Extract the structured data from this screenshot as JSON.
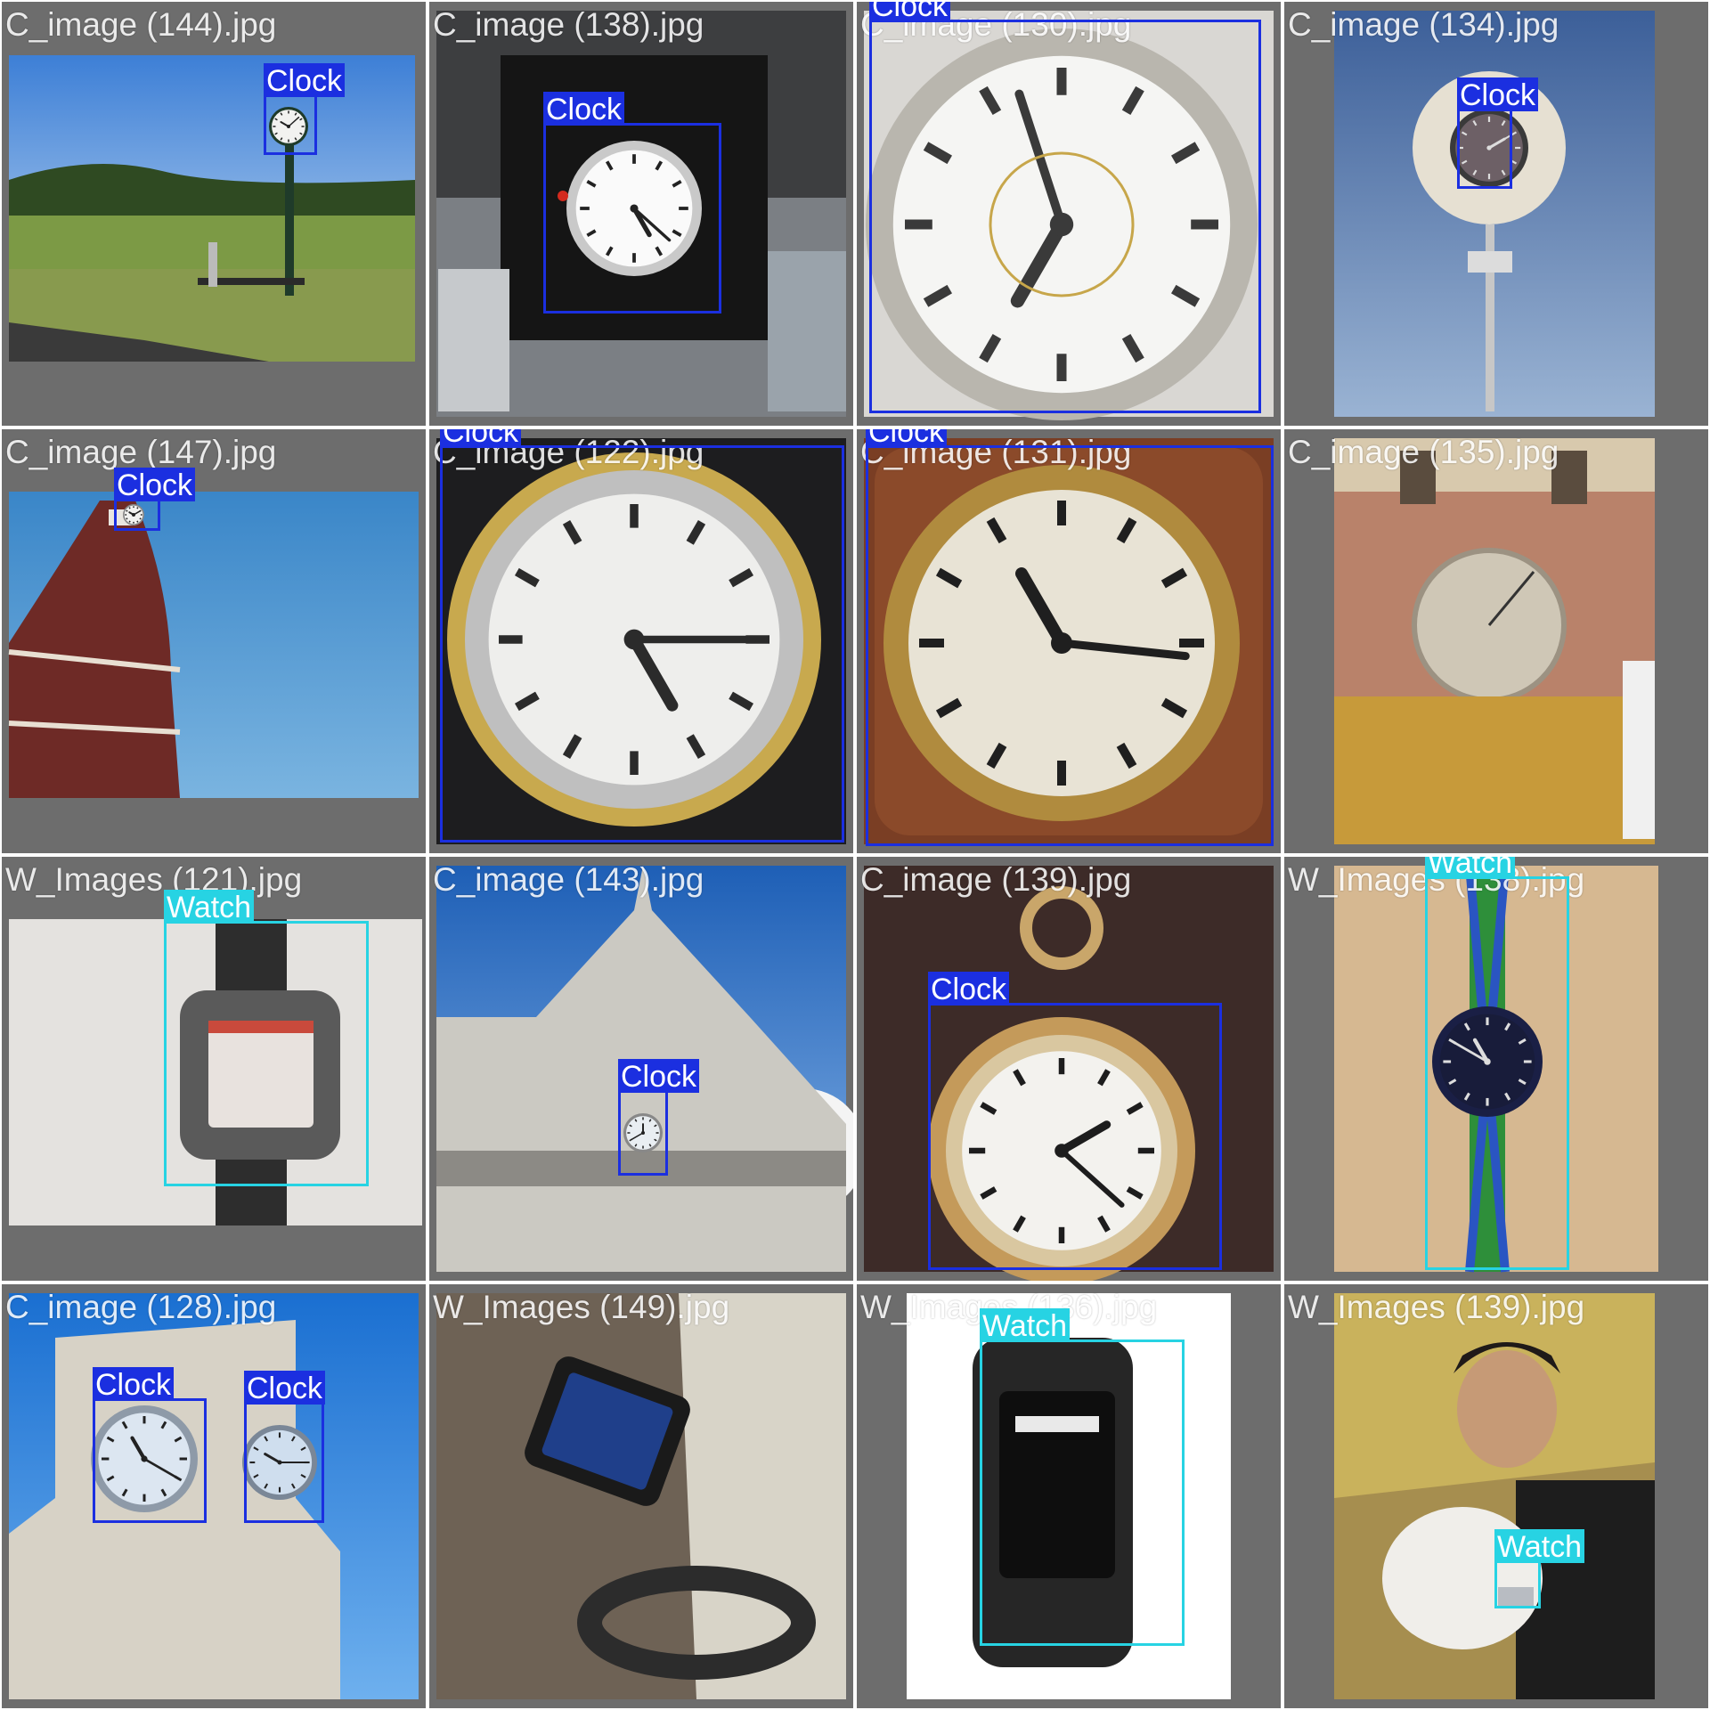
{
  "colors": {
    "clock_box": "#1b2fe0",
    "watch_box": "#27d3e3",
    "tile_background": "#6d6d6d"
  },
  "tiles": [
    {
      "filename": "C_image (144).jpg",
      "scene": "golf-course-clock-post",
      "detections": [
        {
          "label": "Clock"
        }
      ]
    },
    {
      "filename": "C_image (138).jpg",
      "scene": "station-clock-store",
      "detections": [
        {
          "label": "Clock"
        }
      ]
    },
    {
      "filename": "C_image (130).jpg",
      "scene": "roman-clock-face-closeup",
      "detections": [
        {
          "label": "Clock"
        }
      ]
    },
    {
      "filename": "C_image (134).jpg",
      "scene": "street-clock-sky",
      "detections": [
        {
          "label": "Clock"
        }
      ]
    },
    {
      "filename": "C_image (147).jpg",
      "scene": "brick-tower-clock",
      "detections": [
        {
          "label": "Clock"
        }
      ]
    },
    {
      "filename": "C_image (122).jpg",
      "scene": "quartz-clock-closeup",
      "detections": [
        {
          "label": "Clock"
        }
      ]
    },
    {
      "filename": "C_image (131).jpg",
      "scene": "brass-roman-clock",
      "detections": [
        {
          "label": "Clock"
        }
      ]
    },
    {
      "filename": "C_image (135).jpg",
      "scene": "sundial-facade",
      "detections": []
    },
    {
      "filename": "W_Images (121).jpg",
      "scene": "smartwatch-on-desk",
      "detections": [
        {
          "label": "Watch"
        }
      ]
    },
    {
      "filename": "C_image (143).jpg",
      "scene": "hotel-de-ville-clock",
      "detections": [
        {
          "label": "Clock"
        }
      ]
    },
    {
      "filename": "C_image (139).jpg",
      "scene": "pocket-watch-display",
      "detections": [
        {
          "label": "Clock"
        }
      ]
    },
    {
      "filename": "W_Images (138).jpg",
      "scene": "braided-strap-watch",
      "detections": [
        {
          "label": "Watch"
        }
      ]
    },
    {
      "filename": "C_image (128).jpg",
      "scene": "tower-two-clocks",
      "detections": [
        {
          "label": "Clock"
        },
        {
          "label": "Clock"
        }
      ]
    },
    {
      "filename": "W_Images (149).jpg",
      "scene": "wrist-smartwatch",
      "detections": []
    },
    {
      "filename": "W_Images (136).jpg",
      "scene": "phone-watch-product",
      "detections": [
        {
          "label": "Watch"
        }
      ]
    },
    {
      "filename": "W_Images (139).jpg",
      "scene": "man-with-dog-watch",
      "detections": [
        {
          "label": "Watch"
        }
      ]
    }
  ]
}
